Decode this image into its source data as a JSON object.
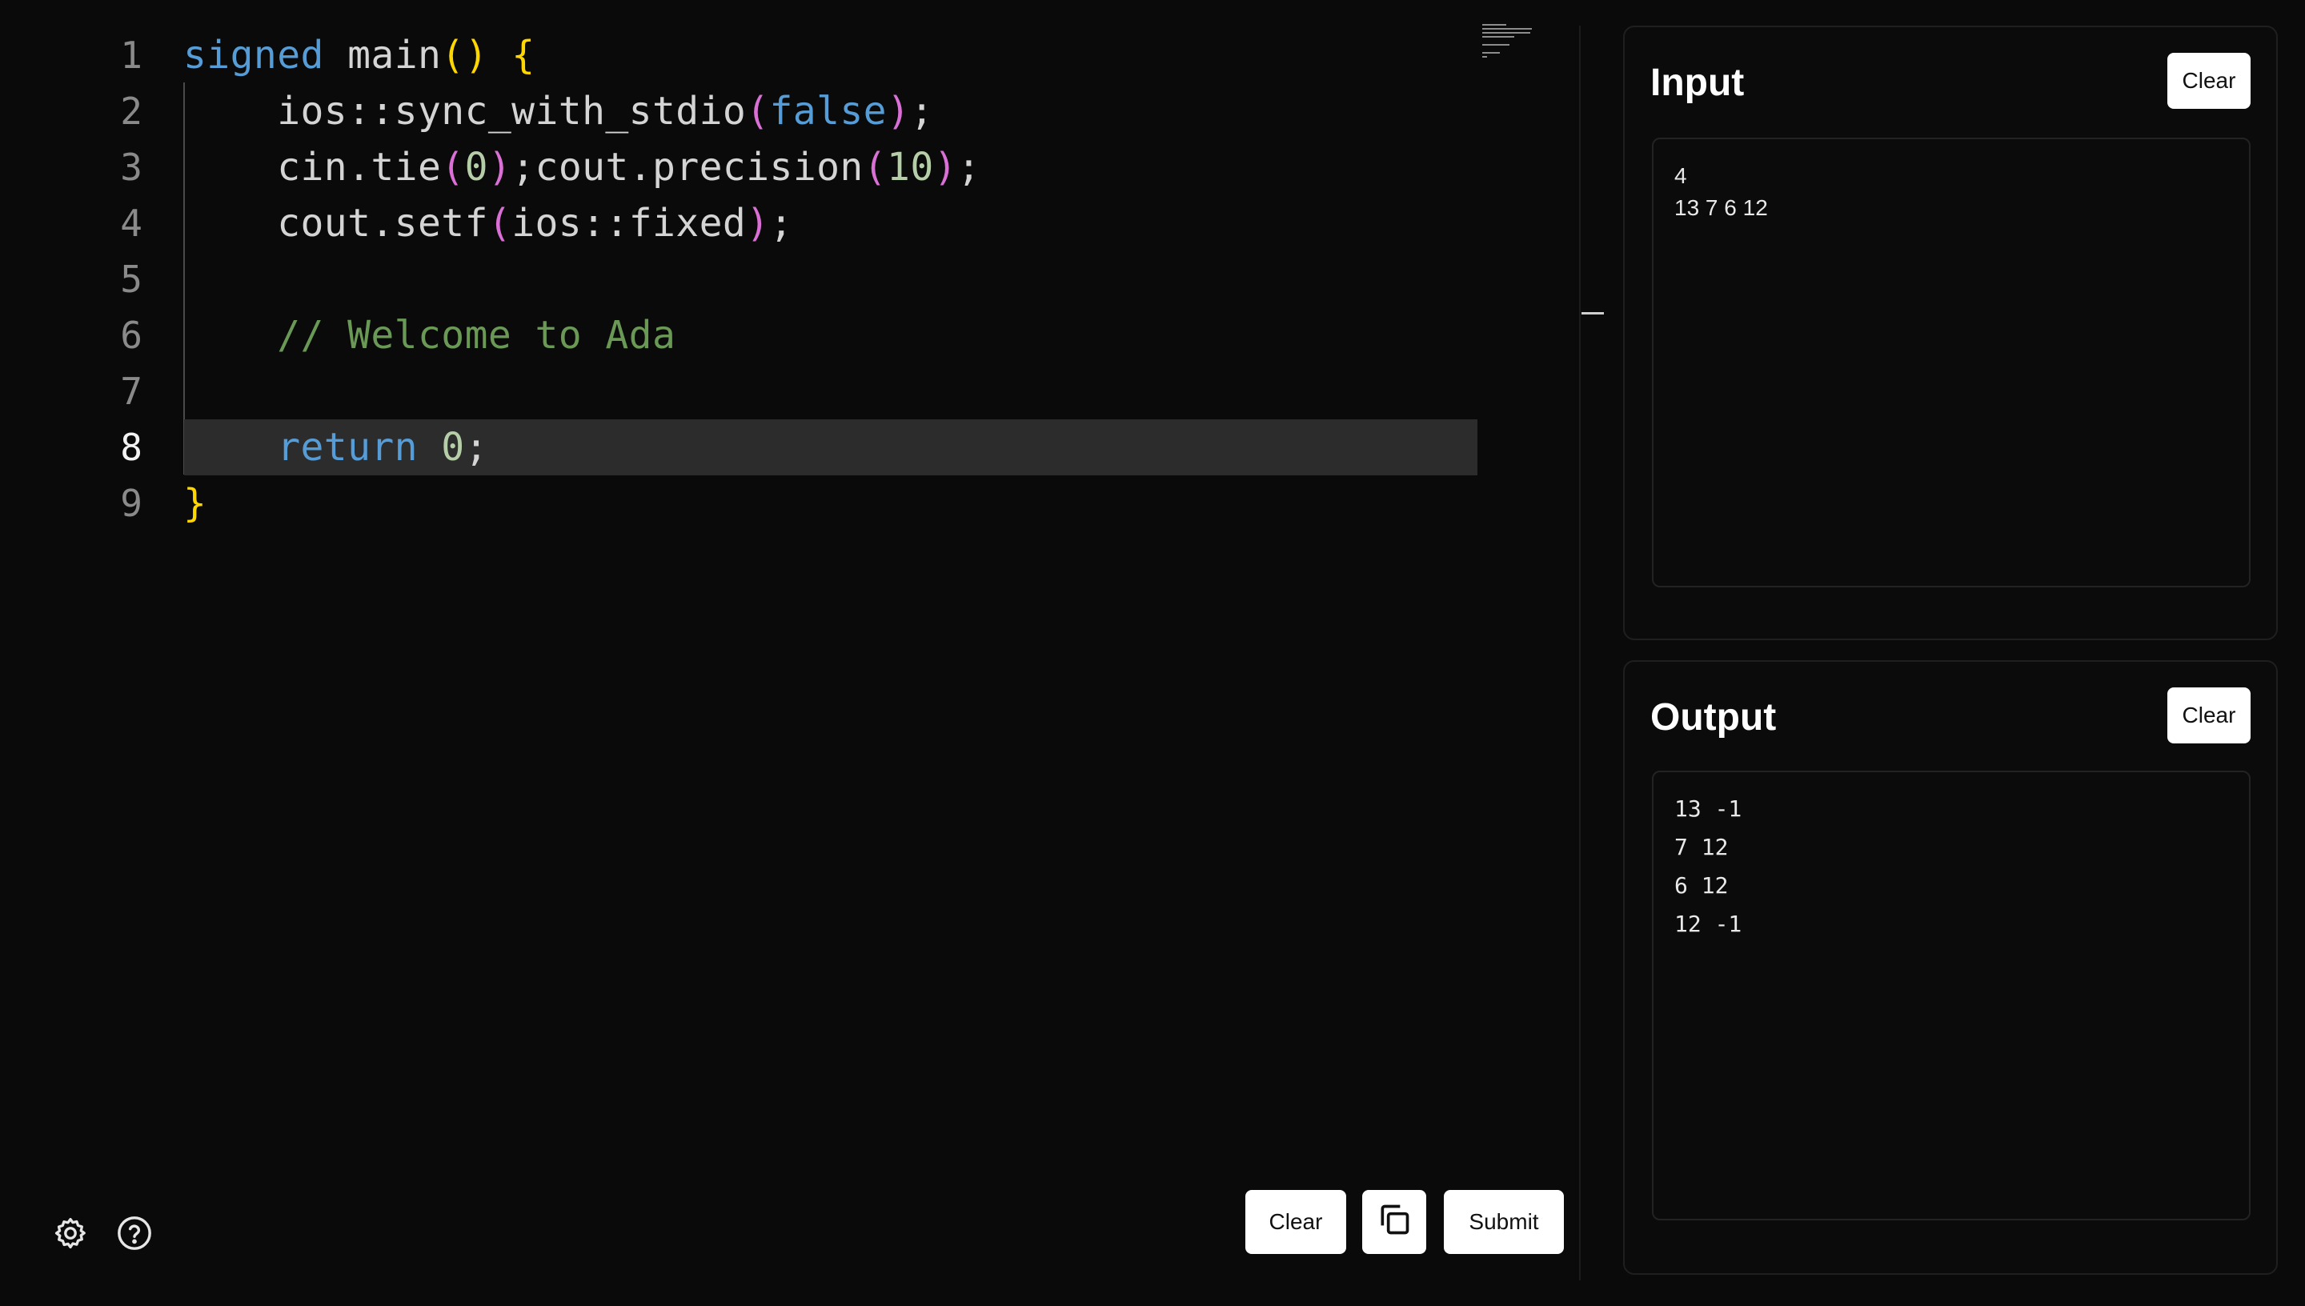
{
  "editor": {
    "lines": [
      {
        "num": "1",
        "parts": [
          {
            "t": "signed",
            "c": "kw"
          },
          {
            "t": " main"
          },
          {
            "t": "()",
            "c": "br1"
          },
          {
            "t": " "
          },
          {
            "t": "{",
            "c": "br1"
          }
        ]
      },
      {
        "num": "2",
        "parts": [
          {
            "t": "    ios::sync_with_stdio"
          },
          {
            "t": "(",
            "c": "br2"
          },
          {
            "t": "false",
            "c": "kw"
          },
          {
            "t": ")",
            "c": "br2"
          },
          {
            "t": ";"
          }
        ]
      },
      {
        "num": "3",
        "parts": [
          {
            "t": "    cin.tie"
          },
          {
            "t": "(",
            "c": "br2"
          },
          {
            "t": "0",
            "c": "num"
          },
          {
            "t": ")",
            "c": "br2"
          },
          {
            "t": ";cout.precision"
          },
          {
            "t": "(",
            "c": "br2"
          },
          {
            "t": "10",
            "c": "num"
          },
          {
            "t": ")",
            "c": "br2"
          },
          {
            "t": ";"
          }
        ]
      },
      {
        "num": "4",
        "parts": [
          {
            "t": "    cout.setf"
          },
          {
            "t": "(",
            "c": "br2"
          },
          {
            "t": "ios::fixed"
          },
          {
            "t": ")",
            "c": "br2"
          },
          {
            "t": ";"
          }
        ]
      },
      {
        "num": "5",
        "parts": []
      },
      {
        "num": "6",
        "parts": [
          {
            "t": "    // Welcome to Ada",
            "c": "com"
          }
        ]
      },
      {
        "num": "7",
        "parts": []
      },
      {
        "num": "8",
        "active": true,
        "parts": [
          {
            "t": "    return",
            "c": "kw"
          },
          {
            "t": " "
          },
          {
            "t": "0",
            "c": "num"
          },
          {
            "t": ";"
          }
        ]
      },
      {
        "num": "9",
        "parts": [
          {
            "t": "}",
            "c": "br1"
          }
        ]
      }
    ],
    "clear_label": "Clear",
    "submit_label": "Submit",
    "copy_icon": "copy-icon"
  },
  "footer": {
    "settings_icon": "gear-icon",
    "help_icon": "help-circle-icon"
  },
  "input_panel": {
    "title": "Input",
    "clear_label": "Clear",
    "value": "4\n13 7 6 12"
  },
  "output_panel": {
    "title": "Output",
    "clear_label": "Clear",
    "value": "13 -1\n7 12\n6 12\n12 -1"
  },
  "colors": {
    "background": "#0a0a0a",
    "keyword": "#569cd6",
    "bracket_outer": "#ffd700",
    "bracket_inner": "#da70d6",
    "number": "#b5cea8",
    "comment": "#6a9955",
    "active_line": "#2c2c2c"
  }
}
